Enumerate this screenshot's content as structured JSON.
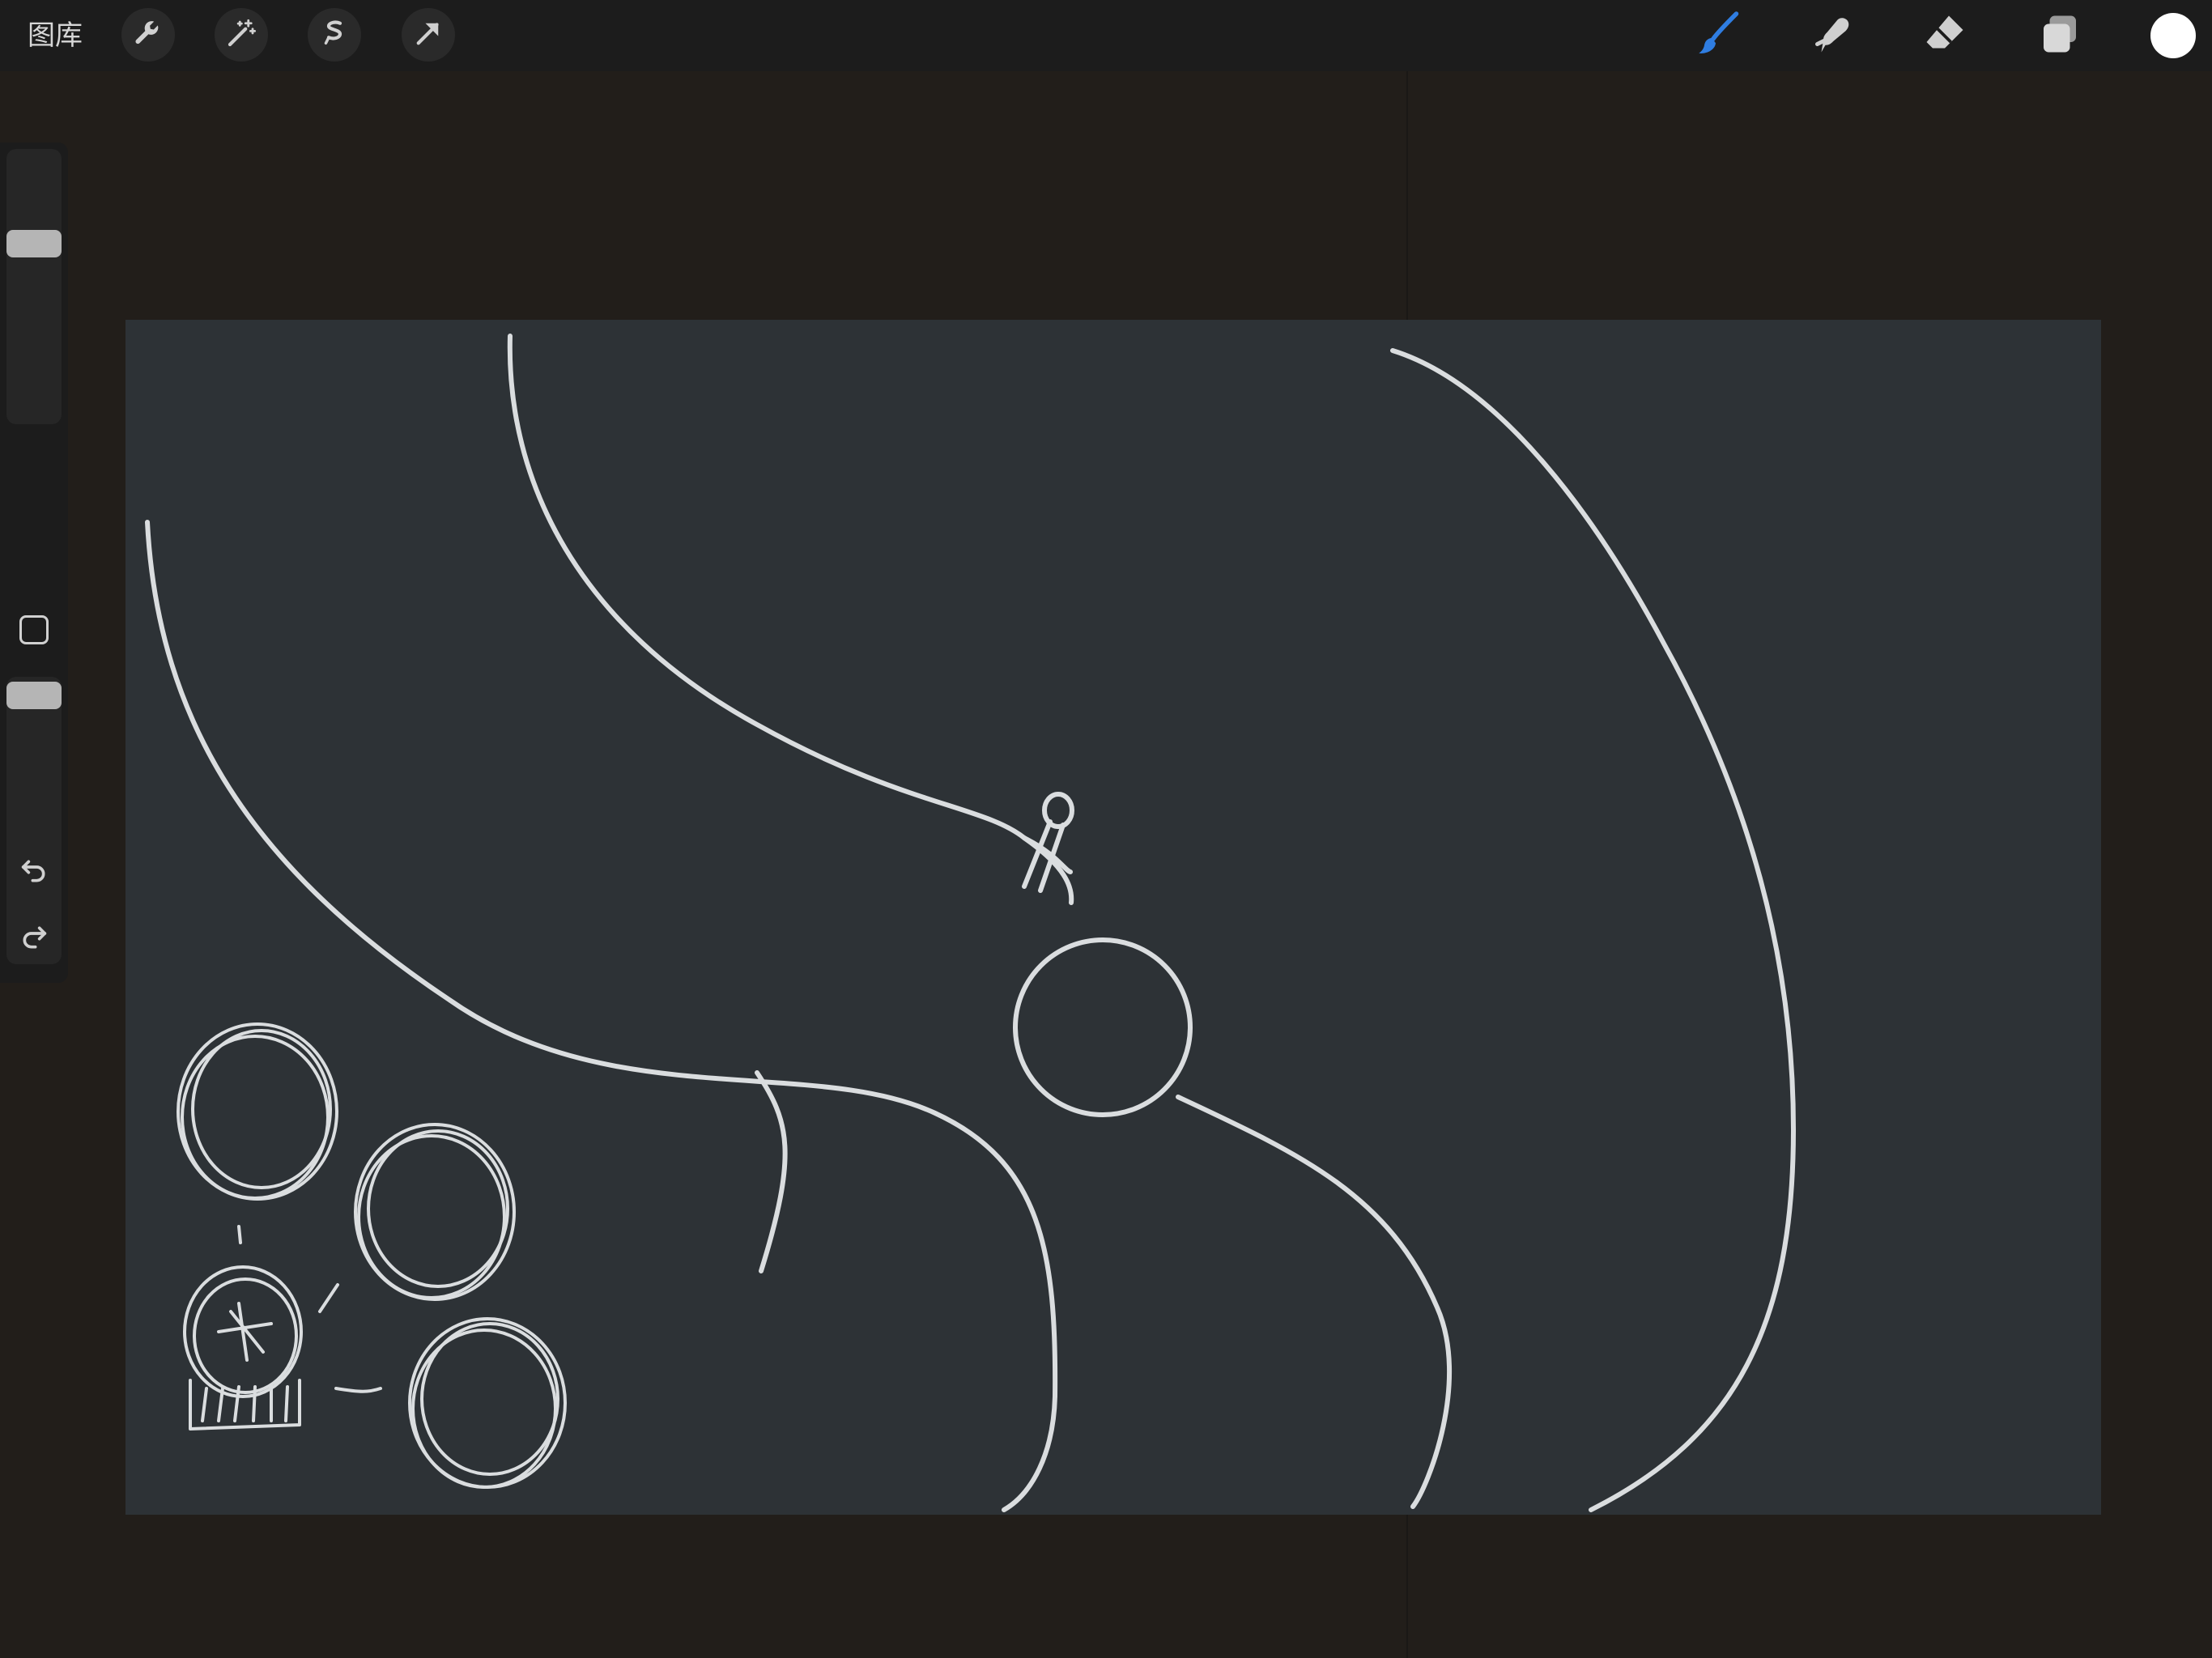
{
  "topbar": {
    "gallery_label": "图库",
    "left_tools": [
      {
        "icon": "wrench-icon"
      },
      {
        "icon": "magic-wand-icon"
      },
      {
        "icon": "selection-icon"
      },
      {
        "icon": "transform-arrow-icon"
      }
    ],
    "right_tools": [
      {
        "icon": "brush-icon",
        "active": true
      },
      {
        "icon": "smudge-icon"
      },
      {
        "icon": "eraser-icon"
      },
      {
        "icon": "layers-icon"
      }
    ],
    "current_color": "#ffffff",
    "active_tool_color": "#2f7de1"
  },
  "sidebar": {
    "brush_size_level": 0.74,
    "opacity_level": 0.95,
    "undo_icon": "undo-icon",
    "redo_icon": "redo-icon"
  },
  "canvas": {
    "background": "#2d3236",
    "stroke_color": "#e9ecee"
  }
}
